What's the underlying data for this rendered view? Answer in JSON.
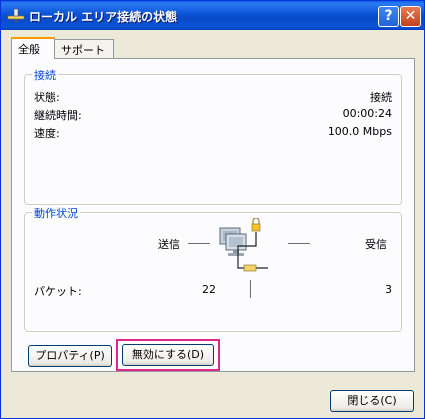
{
  "window": {
    "title": "ローカル エリア接続の状態",
    "help_label": "?",
    "close_label": "✕"
  },
  "tabs": [
    {
      "label": "全般"
    },
    {
      "label": "サポート"
    }
  ],
  "connection": {
    "legend": "接続",
    "rows": [
      {
        "label": "状態:",
        "value": "接続"
      },
      {
        "label": "継続時間:",
        "value": "00:00:24"
      },
      {
        "label": "速度:",
        "value": "100.0 Mbps"
      }
    ]
  },
  "activity": {
    "legend": "動作状況",
    "sent_label": "送信",
    "received_label": "受信",
    "packets_label": "パケット:",
    "packets_sent": "22",
    "packets_received": "3"
  },
  "buttons": {
    "properties": "プロパティ(P)",
    "disable": "無効にする(D)",
    "close": "閉じる(C)"
  },
  "icons": {
    "title": "network-icon",
    "activity": "network-computers-icon"
  }
}
